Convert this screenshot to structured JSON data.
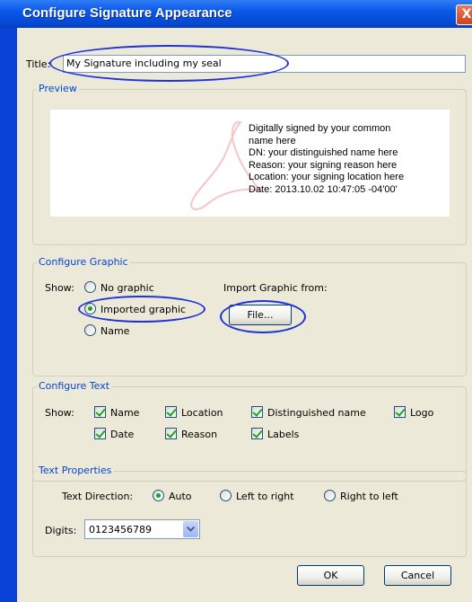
{
  "window": {
    "title": "Configure Signature Appearance",
    "close_symbol": "X"
  },
  "title_field": {
    "label": "Title:",
    "value": "My Signature including my seal"
  },
  "preview": {
    "legend": "Preview",
    "lines": [
      "Digitally signed by your common",
      "name here",
      "DN: your distinguished name here",
      "Reason: your signing reason here",
      "Location: your signing location here",
      "Date: 2013.10.02 10:47:05 -04'00'"
    ]
  },
  "configure_graphic": {
    "legend": "Configure Graphic",
    "show_label": "Show:",
    "options": [
      "No graphic",
      "Imported graphic",
      "Name"
    ],
    "selected": "Imported graphic",
    "import_label": "Import Graphic from:",
    "file_button": "File..."
  },
  "configure_text": {
    "legend": "Configure Text",
    "show_label": "Show:",
    "checkboxes": [
      {
        "label": "Name",
        "checked": true
      },
      {
        "label": "Location",
        "checked": true
      },
      {
        "label": "Distinguished name",
        "checked": true
      },
      {
        "label": "Logo",
        "checked": true
      },
      {
        "label": "Date",
        "checked": true
      },
      {
        "label": "Reason",
        "checked": true
      },
      {
        "label": "Labels",
        "checked": true
      }
    ]
  },
  "text_properties": {
    "legend": "Text Properties",
    "direction_label": "Text Direction:",
    "directions": [
      "Auto",
      "Left to right",
      "Right to left"
    ],
    "selected_direction": "Auto",
    "digits_label": "Digits:",
    "digits_value": "0123456789"
  },
  "buttons": {
    "ok": "OK",
    "cancel": "Cancel"
  },
  "colors": {
    "annotation": "#1d32d8",
    "legend_text": "#0046d5",
    "titlebar": "#0a58e8",
    "dialog_bg": "#ece9d8"
  }
}
